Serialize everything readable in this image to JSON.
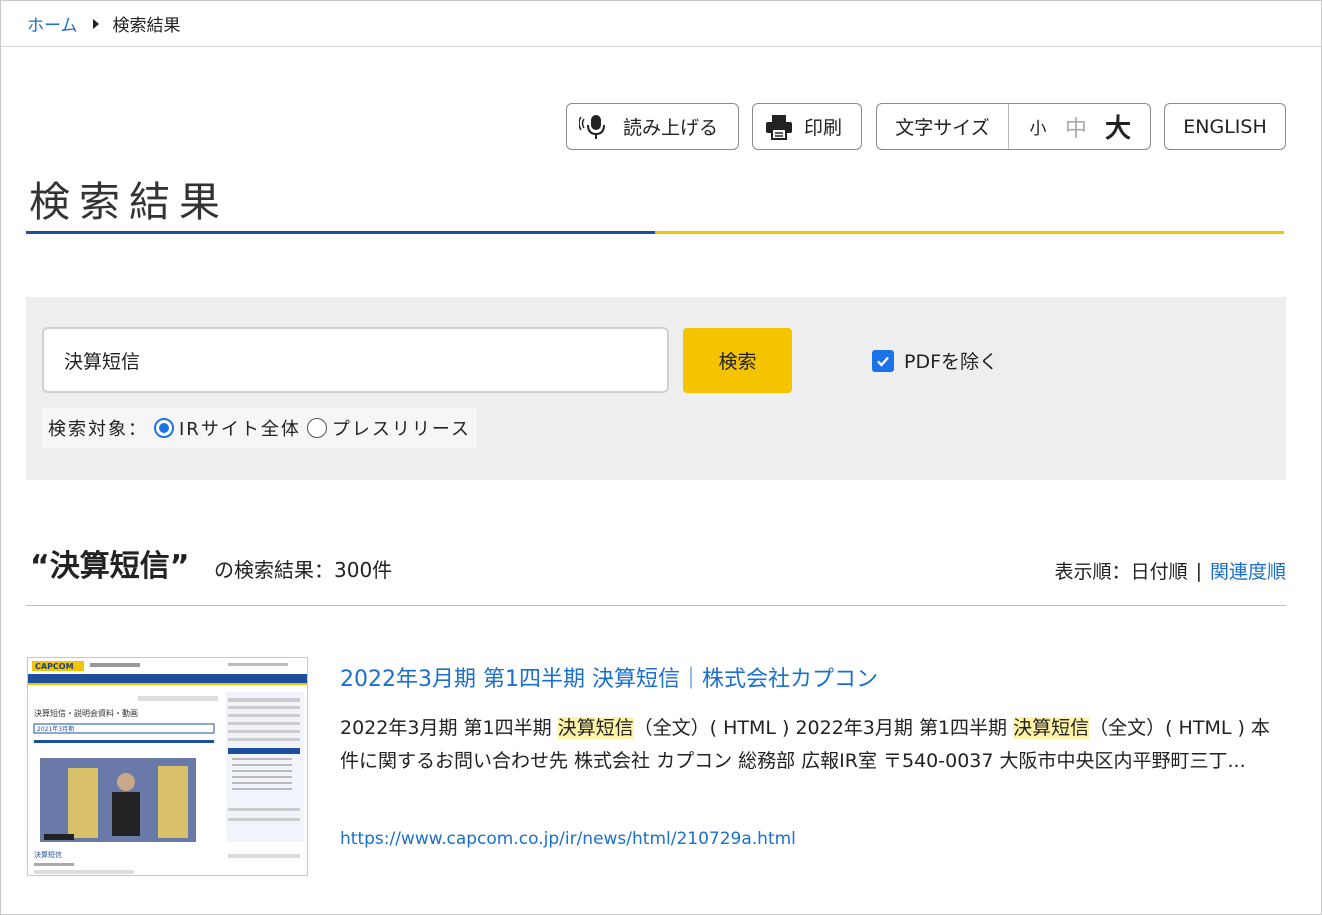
{
  "breadcrumb": {
    "home": "ホーム",
    "current": "検索結果"
  },
  "toolbar": {
    "read_aloud": "読み上げる",
    "print": "印刷",
    "font_size_label": "文字サイズ",
    "font_size_small": "小",
    "font_size_medium": "中",
    "font_size_large": "大",
    "english": "ENGLISH"
  },
  "page": {
    "title": "検索結果"
  },
  "search": {
    "query": "決算短信",
    "button": "検索",
    "exclude_pdf": "PDFを除く",
    "exclude_pdf_checked": true,
    "target_label": "検索対象：",
    "targets": [
      {
        "label": "IRサイト全体",
        "selected": true
      },
      {
        "label": "プレスリリース",
        "selected": false
      }
    ]
  },
  "results": {
    "query_display": "“決算短信”",
    "count_text": "の検索結果：300件",
    "sort_label": "表示順：",
    "sort_date": "日付順",
    "sort_sep": "|",
    "sort_relevance": "関連度順",
    "items": [
      {
        "title": "2022年3月期 第1四半期 決算短信｜株式会社カプコン",
        "snippet": [
          {
            "text": "2022年3月期 第1四半期 ",
            "hl": false
          },
          {
            "text": "決算短信",
            "hl": true
          },
          {
            "text": "（全文）( HTML ) 2022年3月期 第1四半期 ",
            "hl": false
          },
          {
            "text": "決算短信",
            "hl": true
          },
          {
            "text": "（全文）( HTML ) 本件に関するお問い合わせ先 株式会社 カプコン 総務部 広報IR室 〒540-0037 大阪市中央区内平野町三丁...",
            "hl": false
          }
        ],
        "url": "https://www.capcom.co.jp/ir/news/html/210729a.html",
        "thumbnail": {
          "logo": "CAPCOM",
          "heading": "決算短信・説明会資料・動画",
          "year_tab": "2021年3月期",
          "section": "決算短信"
        }
      }
    ]
  },
  "colors": {
    "link": "#1a6fcf",
    "accent_yellow": "#f5c400",
    "accent_blue": "#1d4f9c",
    "highlight": "#fff3a8"
  }
}
